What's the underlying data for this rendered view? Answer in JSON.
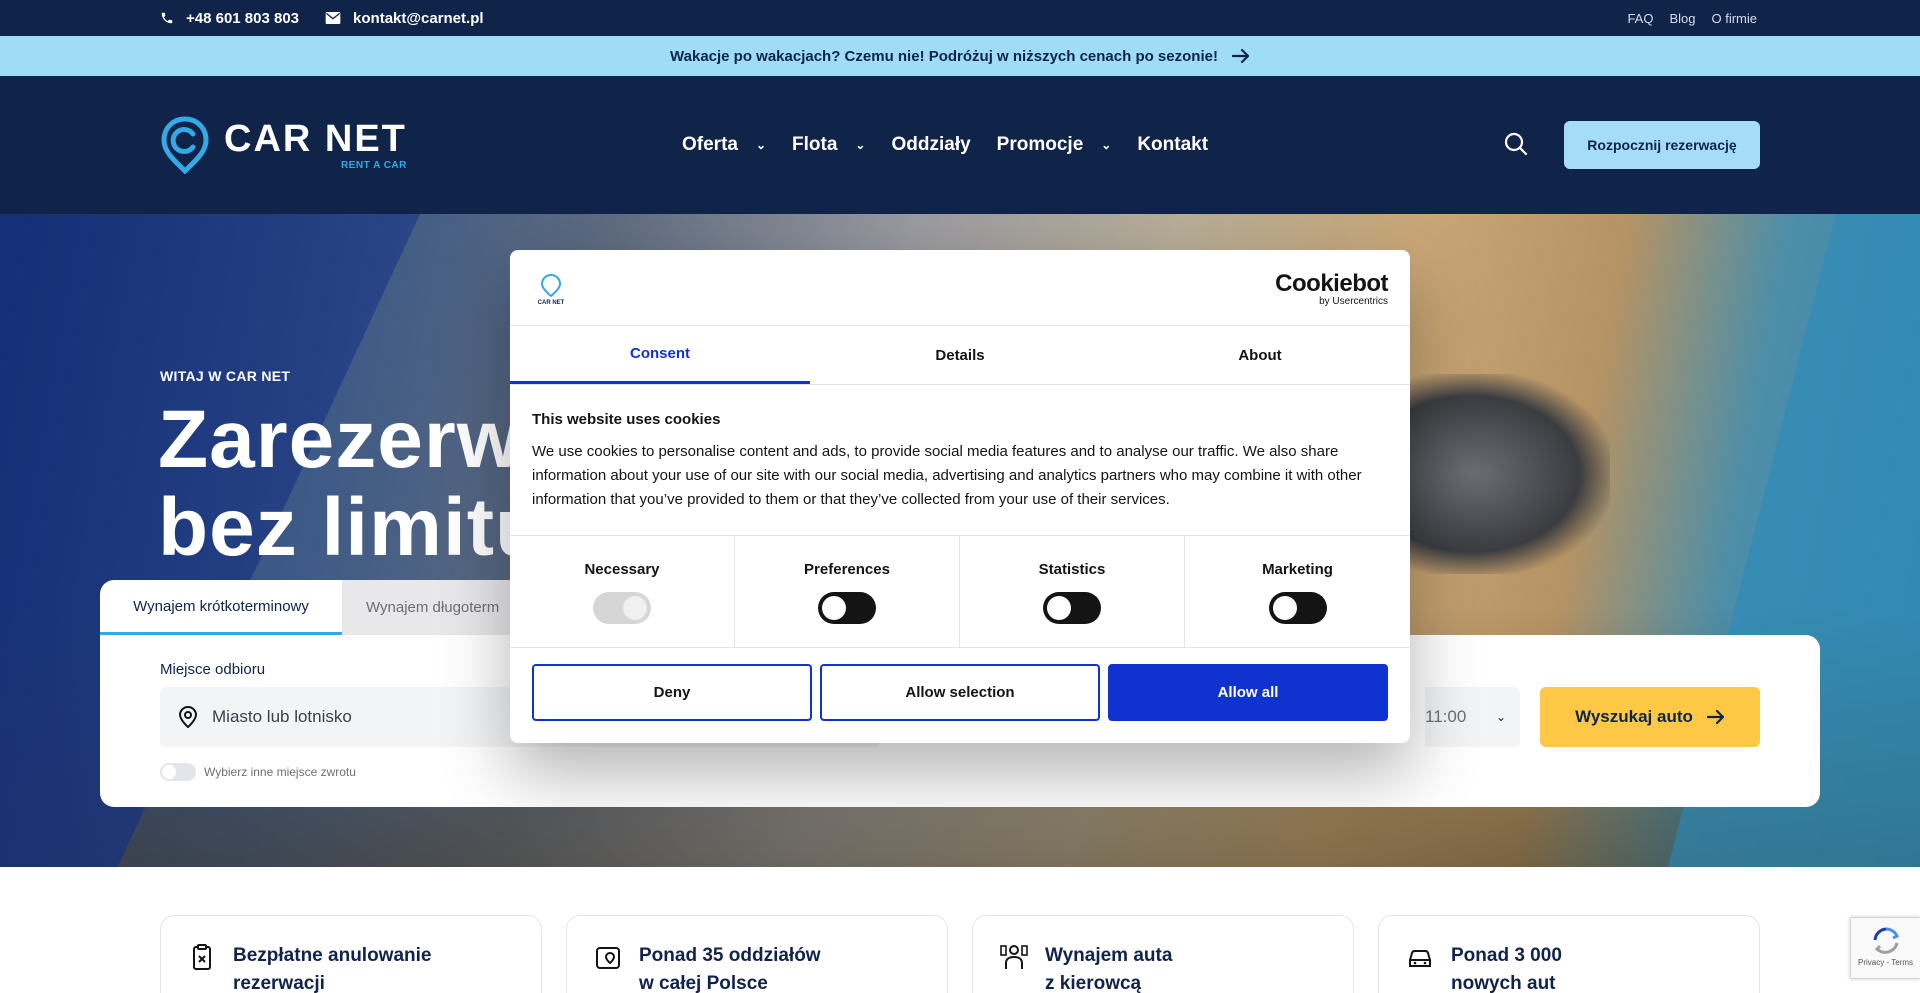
{
  "topbar": {
    "phone": "+48 601 803 803",
    "email": "kontakt@carnet.pl",
    "links": [
      "FAQ",
      "Blog",
      "O firmie"
    ]
  },
  "promo": {
    "text": "Wakacje po wakacjach? Czemu nie! Podróżuj w niższych cenach po sezonie!"
  },
  "header": {
    "logo_text": "CAR NET",
    "logo_sub": "RENT A CAR",
    "nav": [
      {
        "label": "Oferta",
        "dropdown": true
      },
      {
        "label": "Flota",
        "dropdown": true
      },
      {
        "label": "Oddziały",
        "dropdown": false
      },
      {
        "label": "Promocje",
        "dropdown": true
      },
      {
        "label": "Kontakt",
        "dropdown": false
      }
    ],
    "cta": "Rozpocznij rezerwację"
  },
  "hero": {
    "welcome": "WITAJ W CAR NET",
    "headline_line1": "Zarezerwu",
    "headline_line2": "bez limitu"
  },
  "booking": {
    "tabs": [
      "Wynajem krótkoterminowy",
      "Wynajem długoterm"
    ],
    "pickup_label": "Miejsce odbioru",
    "pickup_placeholder": "Miasto lub lotnisko",
    "time_value": "11:00",
    "search_button": "Wyszukaj auto",
    "return_toggle_label": "Wybierz inne miejsce zwrotu"
  },
  "features": [
    {
      "line1": "Bezpłatne anulowanie",
      "line2": "rezerwacji",
      "icon": "cancel-clipboard-icon"
    },
    {
      "line1": "Ponad 35 oddziałów",
      "line2": "w całej Polsce",
      "icon": "map-pin-icon"
    },
    {
      "line1": "Wynajem auta",
      "line2": "z kierowcą",
      "icon": "driver-icon"
    },
    {
      "line1": "Ponad 3 000",
      "line2": "nowych aut",
      "icon": "car-icon"
    }
  ],
  "recaptcha": {
    "text": "Privacy - Terms"
  },
  "cookie": {
    "brand": "Cookiebot",
    "brand_sub": "by Usercentrics",
    "logo_text": "CAR NET",
    "tabs": [
      "Consent",
      "Details",
      "About"
    ],
    "title": "This website uses cookies",
    "body": "We use cookies to personalise content and ads, to provide social media features and to analyse our traffic. We also share information about your use of our site with our social media, advertising and analytics partners who may combine it with other information that you’ve provided to them or that they’ve collected from your use of their services.",
    "categories": [
      "Necessary",
      "Preferences",
      "Statistics",
      "Marketing"
    ],
    "buttons": {
      "deny": "Deny",
      "selection": "Allow selection",
      "all": "Allow all"
    },
    "colors": {
      "accent": "#1032cf"
    }
  },
  "colors": {
    "navy": "#10244a",
    "promo": "#9fdcf6",
    "cta": "#a5dcf7",
    "search": "#fcc845",
    "brand_blue": "#33a9e6"
  }
}
